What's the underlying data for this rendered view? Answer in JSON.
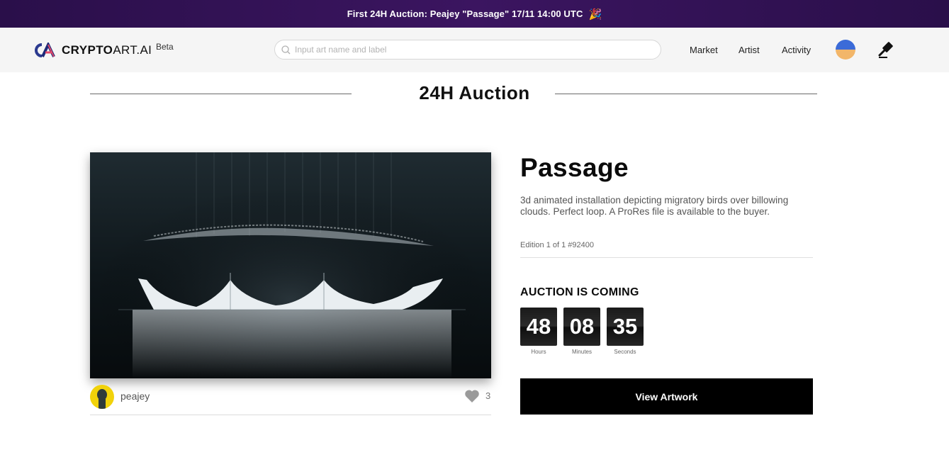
{
  "banner": {
    "text": "First 24H Auction:  Peajey \"Passage\" 17/11 14:00 UTC",
    "icon": "party-popper-icon"
  },
  "header": {
    "logo_bold": "CRYPTO",
    "logo_rest": "ART.AI",
    "beta": "Beta",
    "search_placeholder": "Input art name and label",
    "search_value": "",
    "nav": {
      "market": "Market",
      "artist": "Artist",
      "activity": "Activity"
    }
  },
  "section": {
    "title": "24H Auction"
  },
  "artwork": {
    "creator": "peajey",
    "likes": "3",
    "title": "Passage",
    "description": "3d animated installation depicting migratory birds over billowing clouds. Perfect loop. A ProRes file is available to the buyer.",
    "edition": "Edition 1 of 1 #92400"
  },
  "auction": {
    "label": "AUCTION IS COMING",
    "countdown": [
      {
        "value": "48",
        "label": "Hours"
      },
      {
        "value": "08",
        "label": "Minutes"
      },
      {
        "value": "35",
        "label": "Seconds"
      }
    ],
    "view_button": "View Artwork"
  },
  "colors": {
    "banner": "#2a0f4a",
    "header_bg": "#f5f5f5",
    "button": "#000000",
    "creator_avatar": "#f1d20a"
  }
}
